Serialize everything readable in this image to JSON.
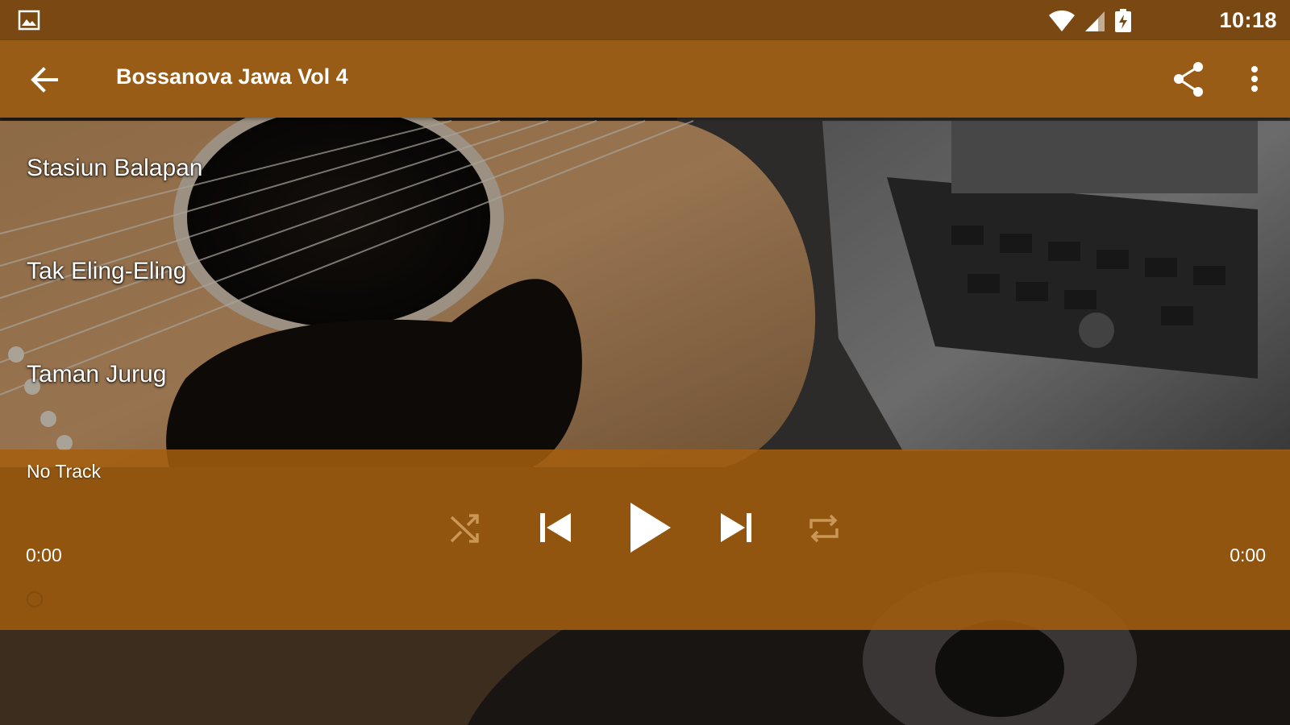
{
  "status_bar": {
    "time": "10:18",
    "icons": [
      "gallery-notification-icon",
      "wifi-icon",
      "cell-signal-icon",
      "battery-charging-icon"
    ]
  },
  "app_bar": {
    "title": "Bossanova Jawa Vol 4",
    "icons": [
      "arrow-back-icon",
      "share-icon",
      "more-vert-icon"
    ],
    "colors": {
      "status_bar": "#7a4812",
      "toolbar": "#995c16"
    }
  },
  "tracks": [
    {
      "title": "Stasiun Balapan"
    },
    {
      "title": "Tak Eling-Eling"
    },
    {
      "title": "Taman Jurug"
    }
  ],
  "player": {
    "now_playing": "No Track",
    "elapsed": "0:00",
    "duration": "0:00",
    "progress": 0,
    "controls": [
      "shuffle-icon",
      "skip-previous-icon",
      "play-icon",
      "skip-next-icon",
      "repeat-icon"
    ],
    "panel_color": "#a45e0e"
  }
}
